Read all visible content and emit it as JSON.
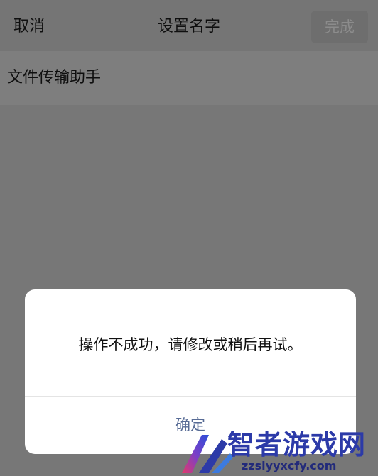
{
  "navbar": {
    "cancel_label": "取消",
    "title": "设置名字",
    "done_label": "完成"
  },
  "name_field": {
    "value": "文件传输助手"
  },
  "dialog": {
    "message": "操作不成功，请修改或稍后再试。",
    "confirm_label": "确定"
  },
  "watermark": {
    "brand": "智者游戏网",
    "url": "zzslyyxcfy.com"
  },
  "colors": {
    "overlay_background": "#777777",
    "dialog_button_text": "#576b95",
    "watermark": "#2c3aa8"
  }
}
